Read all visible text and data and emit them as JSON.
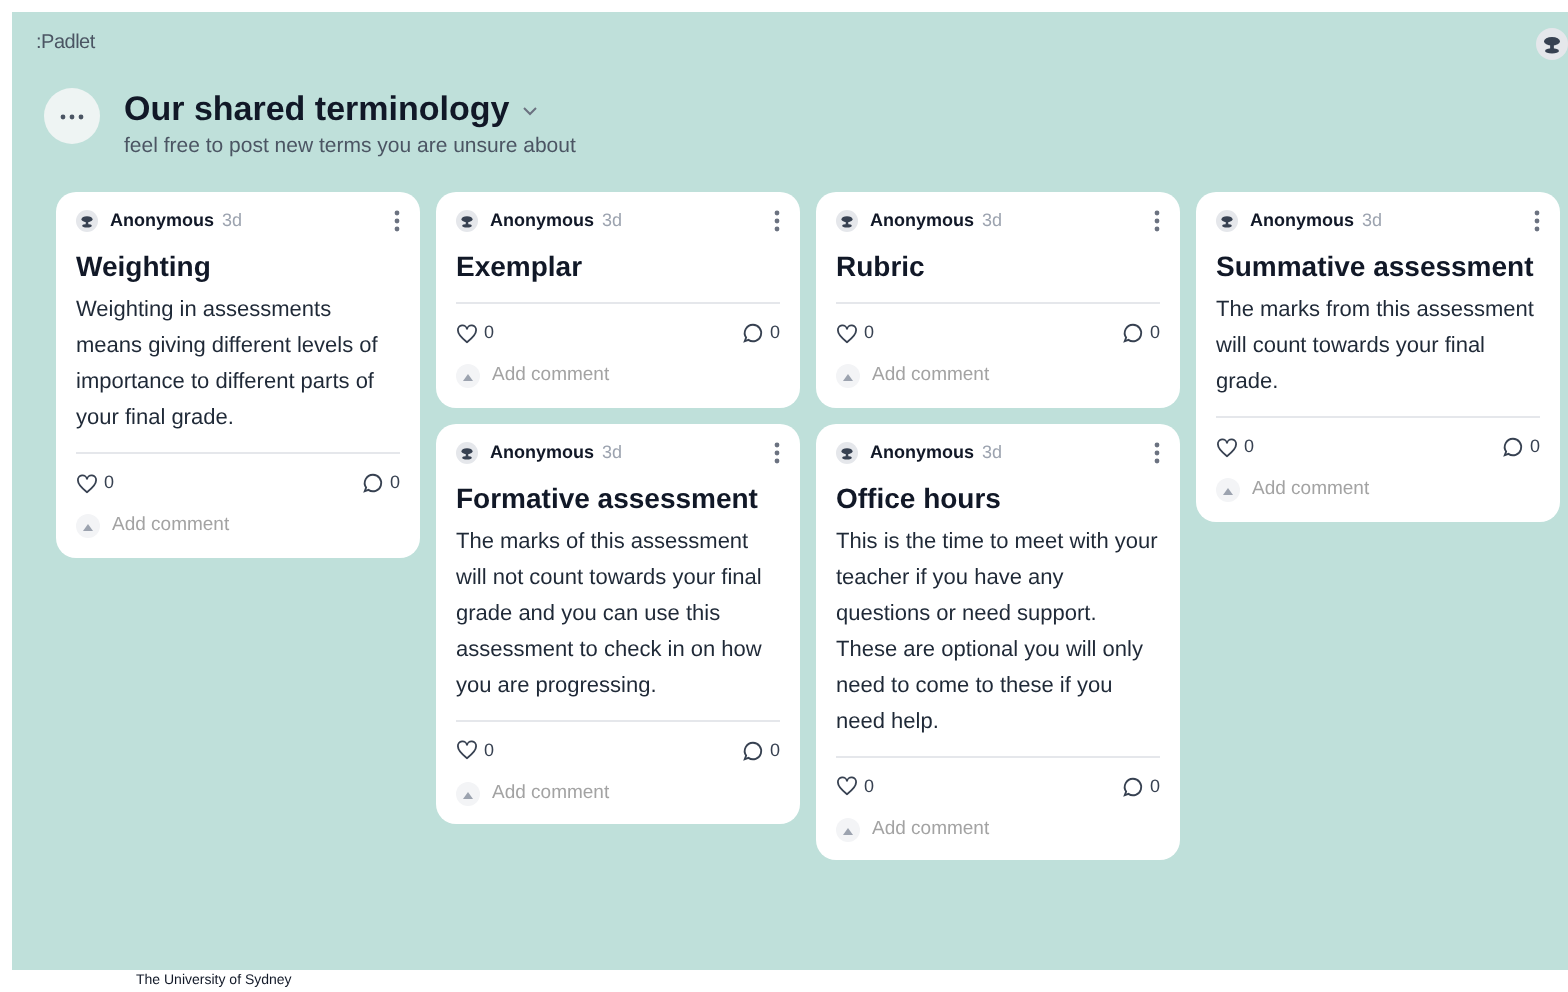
{
  "brand": ":Padlet",
  "board": {
    "title": "Our shared terminology",
    "subtitle": "feel free to post new terms you are unsure about"
  },
  "columns": [
    {
      "posts": [
        {
          "author": "Anonymous",
          "age": "3d",
          "title": "Weighting",
          "body": "Weighting in assessments means giving different levels of importance to different parts of your final grade.",
          "likes": "0",
          "comments": "0",
          "comment_placeholder": "Add comment"
        }
      ]
    },
    {
      "posts": [
        {
          "author": "Anonymous",
          "age": "3d",
          "title": "Exemplar",
          "likes": "0",
          "comments": "0",
          "comment_placeholder": "Add comment"
        },
        {
          "author": "Anonymous",
          "age": "3d",
          "title": "Formative assessment",
          "body": "The marks of this assessment will not count towards your final grade and you can use this assessment to check in on how you are progressing.",
          "likes": "0",
          "comments": "0",
          "comment_placeholder": "Add comment"
        }
      ]
    },
    {
      "posts": [
        {
          "author": "Anonymous",
          "age": "3d",
          "title": "Rubric",
          "likes": "0",
          "comments": "0",
          "comment_placeholder": "Add comment"
        },
        {
          "author": "Anonymous",
          "age": "3d",
          "title": "Office hours",
          "body": "This is the time to meet with your teacher if you have any questions or need support.  These are optional you will only need to come to these if you need help.",
          "likes": "0",
          "comments": "0",
          "comment_placeholder": "Add comment"
        }
      ]
    },
    {
      "posts": [
        {
          "author": "Anonymous",
          "age": "3d",
          "title": "Summative assessment",
          "body": "The marks from this assessment will count towards your final grade.",
          "likes": "0",
          "comments": "0",
          "comment_placeholder": "Add comment"
        }
      ]
    }
  ],
  "footer": "The University of Sydney"
}
